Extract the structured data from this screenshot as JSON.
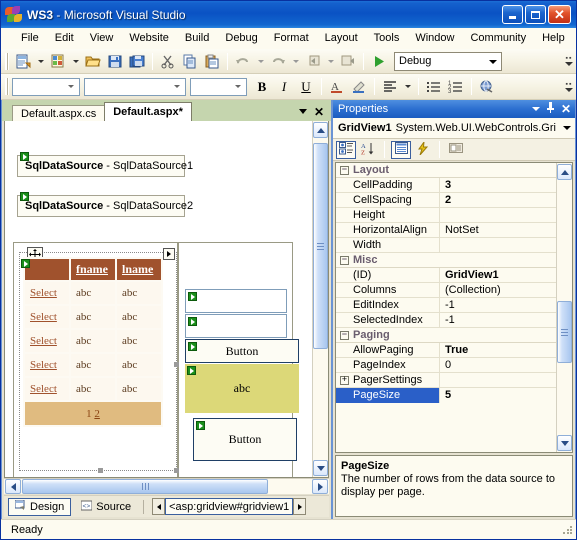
{
  "window": {
    "title_app": "WS3",
    "title_sep": " - ",
    "title_product": "Microsoft Visual Studio",
    "minimize_label": "_",
    "maximize_label": "□",
    "close_label": "✕",
    "logo_icon": "visual-studio-logo"
  },
  "menu": {
    "items": [
      {
        "label": "File"
      },
      {
        "label": "Edit"
      },
      {
        "label": "View"
      },
      {
        "label": "Website"
      },
      {
        "label": "Build"
      },
      {
        "label": "Debug"
      },
      {
        "label": "Format"
      },
      {
        "label": "Layout"
      },
      {
        "label": "Tools"
      },
      {
        "label": "Window"
      },
      {
        "label": "Community"
      },
      {
        "label": "Help"
      }
    ]
  },
  "toolbar_standard": {
    "buttons": [
      {
        "icon": "new-website-icon"
      },
      {
        "icon": "new-website-dropdown-icon"
      },
      {
        "icon": "add-new-item-icon"
      },
      {
        "icon": "add-new-item-dropdown-icon"
      },
      {
        "icon": "open-file-icon"
      },
      {
        "icon": "save-icon"
      },
      {
        "icon": "save-all-icon"
      },
      {
        "icon": "cut-icon"
      },
      {
        "icon": "copy-icon"
      },
      {
        "icon": "paste-icon"
      },
      {
        "icon": "undo-icon"
      },
      {
        "icon": "undo-dropdown-icon"
      },
      {
        "icon": "redo-icon"
      },
      {
        "icon": "redo-dropdown-icon"
      },
      {
        "icon": "navigate-backward-icon"
      },
      {
        "icon": "navigate-backward-dropdown-icon"
      },
      {
        "icon": "navigate-forward-icon"
      },
      {
        "icon": "start-debugging-icon"
      }
    ],
    "config_value": "Debug",
    "overflow_label": "Toolbar Options"
  },
  "toolbar_formatting": {
    "block_format_value": "",
    "font_name_value": "",
    "font_size_value": "",
    "buttons": [
      {
        "icon": "bold-icon",
        "label": "B"
      },
      {
        "icon": "italic-icon",
        "label": "I"
      },
      {
        "icon": "underline-icon",
        "label": "U"
      },
      {
        "icon": "foreground-color-icon",
        "label": "A"
      },
      {
        "icon": "background-color-icon"
      },
      {
        "icon": "justify-left-icon"
      },
      {
        "icon": "justify-dropdown-icon"
      },
      {
        "icon": "bullet-list-icon"
      },
      {
        "icon": "numbered-list-icon"
      },
      {
        "icon": "hyperlink-icon"
      }
    ]
  },
  "document_tabs": {
    "tabs": [
      {
        "label": "Default.aspx.cs",
        "active": false
      },
      {
        "label": "Default.aspx*",
        "active": true
      }
    ],
    "dropdown_icon": "tab-dropdown-icon",
    "close_label": "✕"
  },
  "designer": {
    "datasources": [
      {
        "bold": "SqlDataSource",
        "rest": " - SqlDataSource1"
      },
      {
        "bold": "SqlDataSource",
        "rest": " - SqlDataSource2"
      }
    ],
    "gridview": {
      "headers": [
        "",
        "fname",
        "lname"
      ],
      "rows": [
        [
          "Select",
          "abc",
          "abc"
        ],
        [
          "Select",
          "abc",
          "abc"
        ],
        [
          "Select",
          "abc",
          "abc"
        ],
        [
          "Select",
          "abc",
          "abc"
        ],
        [
          "Select",
          "abc",
          "abc"
        ]
      ],
      "pager_current": "1",
      "pager_next": "2",
      "header_color": "#a0522d",
      "row_color": "#fdf8ef",
      "pager_color": "#e0bb80"
    },
    "right_controls": [
      {
        "type": "textbox",
        "label": ""
      },
      {
        "type": "textbox",
        "label": ""
      },
      {
        "type": "button",
        "label": "Button"
      },
      {
        "type": "label",
        "label": "abc"
      },
      {
        "type": "button",
        "label": "Button"
      }
    ],
    "smart_tag_icon": "smart-tag-icon",
    "move_handle_icon": "move-handle-icon"
  },
  "viewbar": {
    "design_label": "Design",
    "design_icon": "design-view-icon",
    "source_label": "Source",
    "source_icon": "source-view-icon",
    "tag_navigator": "<asp:gridview#gridview1",
    "nav_prev_icon": "tag-nav-prev-icon",
    "nav_next_icon": "tag-nav-next-icon"
  },
  "properties": {
    "title": "Properties",
    "dropdown_icon": "window-dropdown-icon",
    "pin_icon": "auto-hide-pin-icon",
    "close_label": "✕",
    "object_name": "GridView1",
    "object_type": "System.Web.UI.WebControls.Gri",
    "toolbar": [
      {
        "icon": "categorized-view-icon",
        "selected": true
      },
      {
        "icon": "alphabetical-sort-icon",
        "selected": false
      },
      {
        "icon": "properties-page-icon",
        "selected": true
      },
      {
        "icon": "events-lightning-icon",
        "selected": false
      },
      {
        "icon": "property-pages-icon",
        "selected": false
      }
    ],
    "groups": [
      {
        "name": "Layout",
        "expander": "−",
        "rows": [
          {
            "name": "CellPadding",
            "value": "3",
            "bold": true,
            "selected": false
          },
          {
            "name": "CellSpacing",
            "value": "2",
            "bold": true,
            "selected": false
          },
          {
            "name": "Height",
            "value": "",
            "bold": false,
            "selected": false
          },
          {
            "name": "HorizontalAlign",
            "value": "NotSet",
            "bold": false,
            "selected": false
          },
          {
            "name": "Width",
            "value": "",
            "bold": false,
            "selected": false
          }
        ]
      },
      {
        "name": "Misc",
        "expander": "−",
        "rows": [
          {
            "name": "(ID)",
            "value": "GridView1",
            "bold": true,
            "selected": false
          },
          {
            "name": "Columns",
            "value": "(Collection)",
            "bold": false,
            "selected": false
          },
          {
            "name": "EditIndex",
            "value": "-1",
            "bold": false,
            "selected": false
          },
          {
            "name": "SelectedIndex",
            "value": "-1",
            "bold": false,
            "selected": false
          }
        ]
      },
      {
        "name": "Paging",
        "expander": "−",
        "rows": [
          {
            "name": "AllowPaging",
            "value": "True",
            "bold": true,
            "selected": false
          },
          {
            "name": "PageIndex",
            "value": "0",
            "bold": false,
            "selected": false
          },
          {
            "name": "PagerSettings",
            "value": "",
            "bold": false,
            "selected": false,
            "expander": "+"
          },
          {
            "name": "PageSize",
            "value": "5",
            "bold": true,
            "selected": true
          }
        ]
      }
    ],
    "help_title": "PageSize",
    "help_text": "The number of rows from the data source to display per page."
  },
  "statusbar": {
    "text": "Ready"
  },
  "colors": {
    "title_blue": "#0a52c4",
    "menu_bg": "#fdfbf0",
    "selection_blue": "#2a5fc8",
    "tab_strip": "#c5d5ae"
  }
}
